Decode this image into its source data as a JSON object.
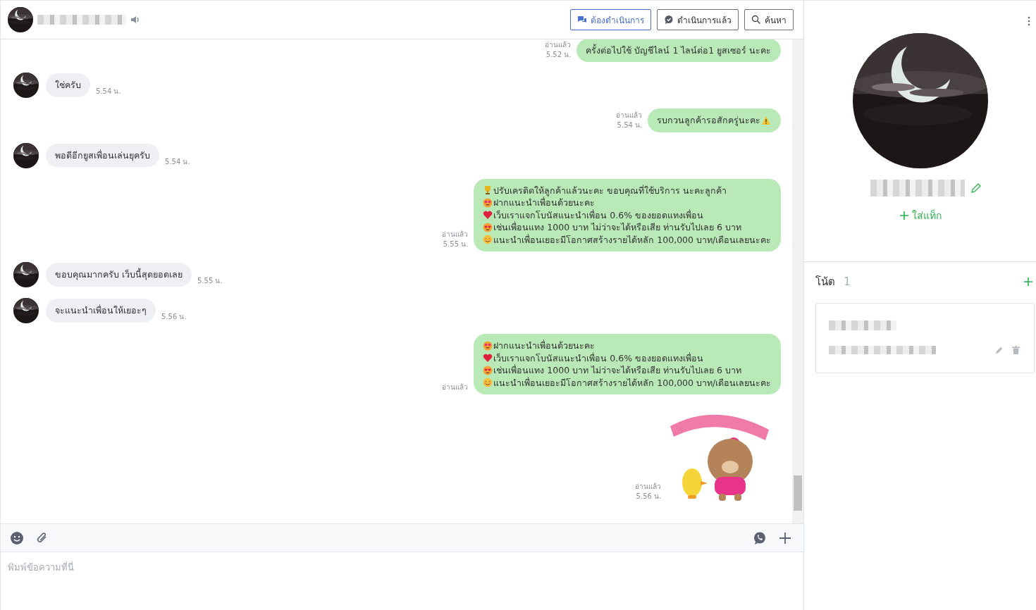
{
  "chat_header": {
    "buttons": [
      {
        "label": "ต้องดำเนินการ",
        "kind": "todo",
        "selected": true
      },
      {
        "label": "ดำเนินการแล้ว",
        "kind": "done",
        "selected": false
      },
      {
        "label": "ค้นหา",
        "kind": "search",
        "selected": false
      }
    ]
  },
  "messages": [
    {
      "kind": "outgoing",
      "lines": [
        {
          "kind": "plain",
          "text": "ครั้งต่อไปใช้ บัญชีไลน์ 1 ไลน์ต่อ1 ยูสเซอร์ นะคะ"
        }
      ],
      "read": "อ่านแล้ว",
      "time": "5.52 น."
    },
    {
      "kind": "incoming",
      "text": "ใช่ครับ",
      "time": "5.54 น."
    },
    {
      "kind": "outgoing",
      "lines": [
        {
          "kind": "warning",
          "text": "รบกวนลูกค้ารอสักครู่นะคะ"
        }
      ],
      "read": "อ่านแล้ว",
      "time": "5.54 น."
    },
    {
      "kind": "incoming",
      "text": "พอดีอีกยูสเพื่อนเล่นยุครับ",
      "time": "5.54 น."
    },
    {
      "kind": "outgoing",
      "lines": [
        {
          "kind": "trophy",
          "text": " ปรับเครดิตให้ลูกค้าแล้วนะคะ ขอบคุณที่ใช้บริการ นะคะลูกค้า"
        },
        {
          "kind": "starstruck",
          "text": "ฝากแนะนำเพื่อนด้วยนะคะ"
        },
        {
          "kind": "heart",
          "text": "เว็บเราแจกโบนัสแนะนำเพื่อน 0.6% ของยอดแทงเพื่อน"
        },
        {
          "kind": "lovestruck",
          "text": "เช่นเพื่อนแทง 1000 บาท ไม่ว่าจะได้หรือเสีย ท่านรับไปเลย 6 บาท"
        },
        {
          "kind": "smile",
          "text": "แนะนำเพื่อนเยอะมีโอกาศสร้างรายได้หลัก 100,000 บาท/เดือนเลยนะคะ"
        }
      ],
      "read": "อ่านแล้ว",
      "time": "5.55 น."
    },
    {
      "kind": "incoming",
      "text": "ขอบคุณมากครับ  เว็บนี้สุดยอดเลย",
      "time": "5.55 น."
    },
    {
      "kind": "incoming",
      "text": "จะแนะนำเพื่อนให้เยอะๆ",
      "time": "5.56 น."
    },
    {
      "kind": "outgoing",
      "lines": [
        {
          "kind": "starstruck",
          "text": "ฝากแนะนำเพื่อนด้วยนะคะ"
        },
        {
          "kind": "heart",
          "text": "เว็บเราแจกโบนัสแนะนำเพื่อน 0.6% ของยอดแทงเพื่อน"
        },
        {
          "kind": "lovestruck",
          "text": "เช่นเพื่อนแทง 1000 บาท ไม่ว่าจะได้หรือเสีย ท่านรับไปเลย 6 บาท"
        },
        {
          "kind": "smile",
          "text": "แนะนำเพื่อนเยอะมีโอกาศสร้างรายได้หลัก 100,000 บาท/เดือนเลยนะคะ"
        }
      ],
      "read": "อ่านแล้ว"
    },
    {
      "kind": "sticker",
      "read": "อ่านแล้ว",
      "time": "5.56 น."
    }
  ],
  "composer": {
    "placeholder": "พิมพ์ข้อความที่นี่"
  },
  "profile": {
    "tag_button": "ใส่แท็ก",
    "notes": {
      "title": "โน้ต",
      "count": "1"
    }
  }
}
